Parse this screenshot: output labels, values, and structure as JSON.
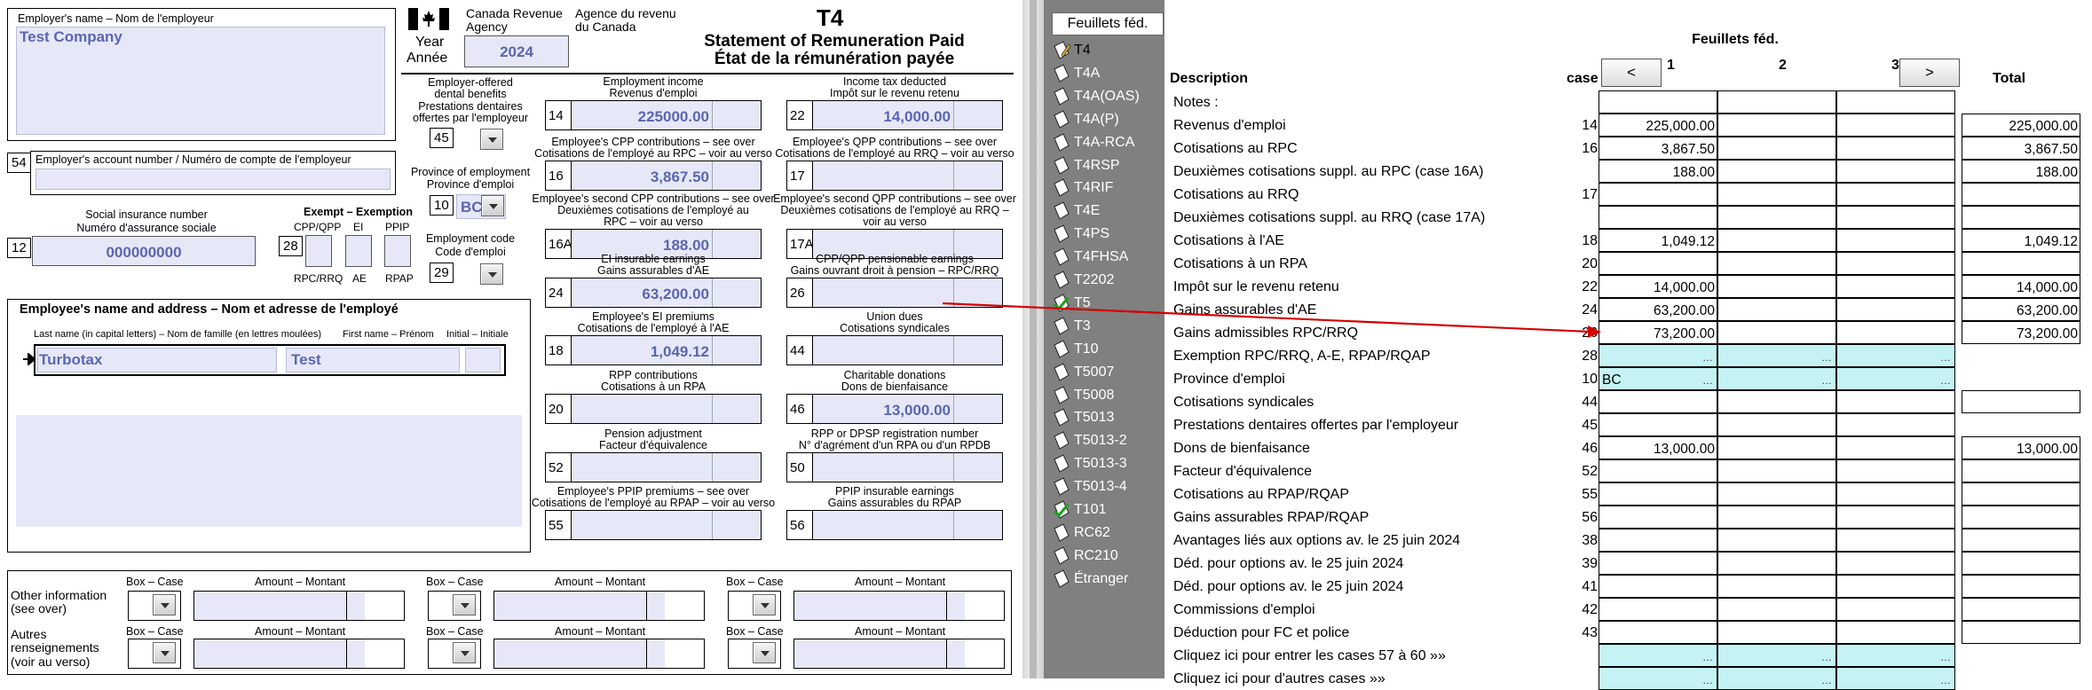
{
  "form": {
    "title": "T4",
    "agency_en": "Canada Revenue\nAgency",
    "agency_fr": "Agence du revenu\ndu Canada",
    "statement_en": "Statement of Remuneration Paid",
    "statement_fr": "État de la rémunération payée",
    "year_label_en": "Year",
    "year_label_fr": "Année",
    "year_value": "2024",
    "employer_name_label": "Employer's name – Nom de l'employeur",
    "employer_name_value": "Test Company",
    "account_box": "54",
    "account_label": "Employer's account number / Numéro de compte de l'employeur",
    "sin_box": "12",
    "sin_label_en": "Social insurance number",
    "sin_label_fr": "Numéro d'assurance sociale",
    "sin_value": "000000000",
    "exempt_label": "Exempt – Exemption",
    "exempt_box": "28",
    "exempt_cols_top": [
      "CPP/QPP",
      "EI",
      "PPIP"
    ],
    "exempt_cols_bottom": [
      "RPC/RRQ",
      "AE",
      "RPAP"
    ],
    "dental_label_en": "Employer-offered\ndental benefits",
    "dental_label_fr": "Prestations dentaires\noffertes par l'employeur",
    "dental_box": "45",
    "province_label_en": "Province of employment",
    "province_label_fr": "Province d'emploi",
    "province_box": "10",
    "province_value": "BC",
    "emp_code_label_en": "Employment code",
    "emp_code_label_fr": "Code d'emploi",
    "emp_code_box": "29",
    "employee_section_label": "Employee's name and address – Nom et adresse de l'employé",
    "last_name_label": "Last name (in capital letters) – Nom de famille (en lettres moulées)",
    "first_name_label": "First name – Prénom",
    "initial_label": "Initial – Initiale",
    "last_name_value": "Turbotax",
    "first_name_value": "Test",
    "boxes": [
      {
        "num": "14",
        "label": "Employment income\nRevenus d'emploi",
        "value": "225000.00"
      },
      {
        "num": "22",
        "label": "Income tax deducted\nImpôt sur le revenu retenu",
        "value": "14,000.00"
      },
      {
        "num": "16",
        "label": "Employee's CPP contributions – see over\nCotisations de l'employé au RPC – voir au verso",
        "value": "3,867.50"
      },
      {
        "num": "17",
        "label": "Employee's QPP contributions – see over\nCotisations de l'employé au RRQ – voir au verso",
        "value": ""
      },
      {
        "num": "16A",
        "label": "Employee's second CPP contributions – see over\nDeuxièmes cotisations de l'employé au\nRPC – voir au verso",
        "value": "188.00"
      },
      {
        "num": "17A",
        "label": "Employee's second QPP contributions – see over\nDeuxièmes cotisations de l'employé au RRQ –\nvoir au verso",
        "value": ""
      },
      {
        "num": "24",
        "label": "EI insurable earnings\nGains assurables d'AE",
        "value": "63,200.00"
      },
      {
        "num": "26",
        "label": "CPP/QPP pensionable earnings\nGains ouvrant droit à pension – RPC/RRQ",
        "value": ""
      },
      {
        "num": "18",
        "label": "Employee's EI premiums\nCotisations de l'employé à l'AE",
        "value": "1,049.12"
      },
      {
        "num": "44",
        "label": "Union dues\nCotisations syndicales",
        "value": ""
      },
      {
        "num": "20",
        "label": "RPP contributions\nCotisations à un RPA",
        "value": ""
      },
      {
        "num": "46",
        "label": "Charitable donations\nDons de bienfaisance",
        "value": "13,000.00"
      },
      {
        "num": "52",
        "label": "Pension adjustment\nFacteur d'équivalence",
        "value": ""
      },
      {
        "num": "50",
        "label": "RPP or DPSP registration number\nN° d'agrément d'un RPA ou d'un RPDB",
        "value": ""
      },
      {
        "num": "55",
        "label": "Employee's PPIP premiums – see over\nCotisations de l'employé au RPAP – voir au verso",
        "value": ""
      },
      {
        "num": "56",
        "label": "PPIP insurable earnings\nGains assurables du RPAP",
        "value": ""
      }
    ],
    "other_info_en": "Other information\n(see over)",
    "other_info_fr": "Autres\nrenseignements\n(voir au verso)",
    "box_case_label": "Box – Case",
    "amount_label": "Amount – Montant"
  },
  "sidebar": {
    "header": "Feuillets féd.",
    "items": [
      {
        "label": "T4",
        "checked": false,
        "active": true
      },
      {
        "label": "T4A",
        "checked": false
      },
      {
        "label": "T4A(OAS)",
        "checked": false
      },
      {
        "label": "T4A(P)",
        "checked": false
      },
      {
        "label": "T4A-RCA",
        "checked": false
      },
      {
        "label": "T4RSP",
        "checked": false
      },
      {
        "label": "T4RIF",
        "checked": false
      },
      {
        "label": "T4E",
        "checked": false
      },
      {
        "label": "T4PS",
        "checked": false
      },
      {
        "label": "T4FHSA",
        "checked": false
      },
      {
        "label": "T2202",
        "checked": false
      },
      {
        "label": "T5",
        "checked": true
      },
      {
        "label": "T3",
        "checked": false
      },
      {
        "label": "T10",
        "checked": false
      },
      {
        "label": "T5007",
        "checked": false
      },
      {
        "label": "T5008",
        "checked": false
      },
      {
        "label": "T5013",
        "checked": false
      },
      {
        "label": "T5013-2",
        "checked": false
      },
      {
        "label": "T5013-3",
        "checked": false
      },
      {
        "label": "T5013-4",
        "checked": false
      },
      {
        "label": "T101",
        "checked": true
      },
      {
        "label": "RC62",
        "checked": false
      },
      {
        "label": "RC210",
        "checked": false
      },
      {
        "label": "Étranger",
        "checked": false
      }
    ]
  },
  "table": {
    "title": "Feuillets féd.",
    "desc_header": "Description",
    "case_header": "case",
    "prev_button": "<",
    "next_button": ">",
    "col_headers": [
      "1",
      "2",
      "3"
    ],
    "total_header": "Total",
    "rows": [
      {
        "desc": "Notes :",
        "case": "",
        "c1": "",
        "c2": "",
        "c3": "",
        "total": null,
        "cyan": false
      },
      {
        "desc": "Revenus d'emploi",
        "case": "14",
        "c1": "225,000.00",
        "c2": "",
        "c3": "",
        "total": "225,000.00",
        "cyan": false
      },
      {
        "desc": "Cotisations au RPC",
        "case": "16",
        "c1": "3,867.50",
        "c2": "",
        "c3": "",
        "total": "3,867.50",
        "cyan": false
      },
      {
        "desc": "Deuxièmes cotisations suppl. au RPC (case 16A)",
        "case": "",
        "c1": "188.00",
        "c2": "",
        "c3": "",
        "total": "188.00",
        "cyan": false
      },
      {
        "desc": "Cotisations au RRQ",
        "case": "17",
        "c1": "",
        "c2": "",
        "c3": "",
        "total": "",
        "cyan": false
      },
      {
        "desc": "Deuxièmes cotisations suppl. au RRQ (case 17A)",
        "case": "",
        "c1": "",
        "c2": "",
        "c3": "",
        "total": "",
        "cyan": false
      },
      {
        "desc": "Cotisations à l'AE",
        "case": "18",
        "c1": "1,049.12",
        "c2": "",
        "c3": "",
        "total": "1,049.12",
        "cyan": false
      },
      {
        "desc": "Cotisations à un RPA",
        "case": "20",
        "c1": "",
        "c2": "",
        "c3": "",
        "total": "",
        "cyan": false
      },
      {
        "desc": "Impôt sur le revenu retenu",
        "case": "22",
        "c1": "14,000.00",
        "c2": "",
        "c3": "",
        "total": "14,000.00",
        "cyan": false
      },
      {
        "desc": "Gains assurables d'AE",
        "case": "24",
        "c1": "63,200.00",
        "c2": "",
        "c3": "",
        "total": "63,200.00",
        "cyan": false
      },
      {
        "desc": "Gains admissibles RPC/RRQ",
        "case": "26",
        "c1": "73,200.00",
        "c2": "",
        "c3": "",
        "total": "73,200.00",
        "cyan": false
      },
      {
        "desc": "Exemption RPC/RRQ, A-E, RPAP/RQAP",
        "case": "28",
        "c1": "",
        "c2": "",
        "c3": "",
        "total": null,
        "cyan": true
      },
      {
        "desc": "Province d'emploi",
        "case": "10",
        "c1": "BC",
        "c2": "",
        "c3": "",
        "total": null,
        "cyan": true
      },
      {
        "desc": "Cotisations syndicales",
        "case": "44",
        "c1": "",
        "c2": "",
        "c3": "",
        "total": "",
        "cyan": false
      },
      {
        "desc": "Prestations dentaires offertes par l'employeur",
        "case": "45",
        "c1": "",
        "c2": "",
        "c3": "",
        "total": null,
        "cyan": false
      },
      {
        "desc": "Dons de bienfaisance",
        "case": "46",
        "c1": "13,000.00",
        "c2": "",
        "c3": "",
        "total": "13,000.00",
        "cyan": false
      },
      {
        "desc": "Facteur d'équivalence",
        "case": "52",
        "c1": "",
        "c2": "",
        "c3": "",
        "total": "",
        "cyan": false
      },
      {
        "desc": "Cotisations au RPAP/RQAP",
        "case": "55",
        "c1": "",
        "c2": "",
        "c3": "",
        "total": "",
        "cyan": false
      },
      {
        "desc": "Gains assurables RPAP/RQAP",
        "case": "56",
        "c1": "",
        "c2": "",
        "c3": "",
        "total": "",
        "cyan": false
      },
      {
        "desc": "Avantages liés aux options av. le 25 juin 2024",
        "case": "38",
        "c1": "",
        "c2": "",
        "c3": "",
        "total": "",
        "cyan": false
      },
      {
        "desc": "Déd. pour options av. le 25 juin 2024",
        "case": "39",
        "c1": "",
        "c2": "",
        "c3": "",
        "total": "",
        "cyan": false
      },
      {
        "desc": "Déd. pour options av. le 25 juin 2024",
        "case": "41",
        "c1": "",
        "c2": "",
        "c3": "",
        "total": "",
        "cyan": false
      },
      {
        "desc": "Commissions d'emploi",
        "case": "42",
        "c1": "",
        "c2": "",
        "c3": "",
        "total": "",
        "cyan": false
      },
      {
        "desc": "Déduction pour FC et police",
        "case": "43",
        "c1": "",
        "c2": "",
        "c3": "",
        "total": "",
        "cyan": false
      },
      {
        "desc": "Cliquez ici pour entrer les cases 57 à 60 »»",
        "case": "",
        "c1": "",
        "c2": "",
        "c3": "",
        "total": null,
        "cyan": true
      },
      {
        "desc": "Cliquez ici pour d'autres cases »»",
        "case": "",
        "c1": "",
        "c2": "",
        "c3": "",
        "total": null,
        "cyan": true
      }
    ]
  },
  "colors": {
    "sidebar_bg": "#808080",
    "value_blue": "#5a66b0",
    "field_bg": "#e6e8f8",
    "cyan_cell": "#c5f3f5",
    "arrow_red": "#d40000"
  }
}
